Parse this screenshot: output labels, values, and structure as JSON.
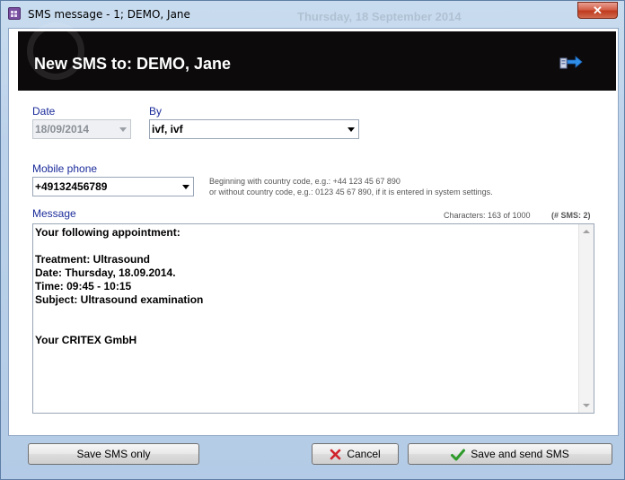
{
  "window": {
    "title": "SMS message - 1; DEMO, Jane",
    "background_text": "Thursday, 18 September 2014",
    "close_glyph": "✕"
  },
  "header": {
    "title": "New SMS to: DEMO, Jane",
    "icon": "export-arrow-icon",
    "background": "#0c0a0b"
  },
  "form": {
    "date_label": "Date",
    "date_value": "18/09/2014",
    "by_label": "By",
    "by_value": "ivf, ivf",
    "mobile_label": "Mobile phone",
    "mobile_value": "+49132456789",
    "hint_line1": "Beginning with country code, e.g.: +44 123 45 67 890",
    "hint_line2": "or without country code, e.g.: 0123 45 67 890, if it is entered in system settings.",
    "message_label": "Message",
    "characters": "Characters: 163 of 1000",
    "sms_count": "(# SMS: 2)",
    "message_lines": [
      "Your following appointment:",
      "",
      "Treatment: Ultrasound",
      "Date: Thursday, 18.09.2014.",
      "Time: 09:45 - 10:15",
      "Subject: Ultrasound examination",
      "",
      "",
      "Your CRITEX GmbH"
    ]
  },
  "buttons": {
    "save_only": "Save SMS only",
    "cancel": "Cancel",
    "save_send": "Save and send SMS"
  },
  "colors": {
    "label": "#1a2b9a",
    "cancel_icon": "#d0222a",
    "send_icon": "#2e9a2a"
  }
}
